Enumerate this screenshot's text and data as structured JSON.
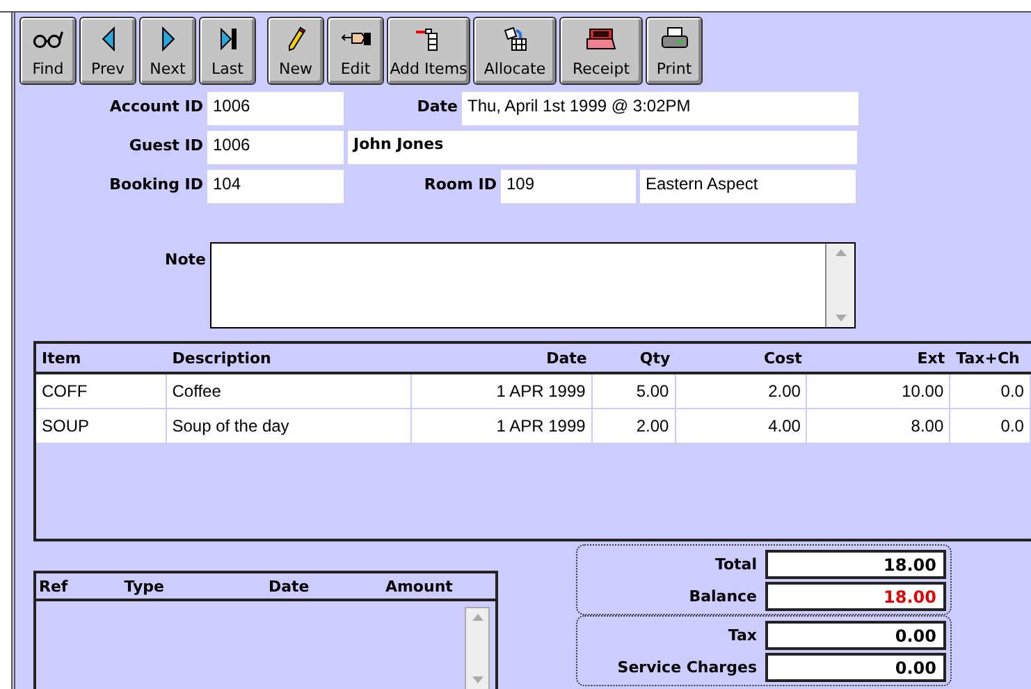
{
  "toolbar": {
    "navigation": [
      {
        "kind": "find",
        "label": "Find"
      },
      {
        "kind": "prev",
        "label": "Prev"
      },
      {
        "kind": "next",
        "label": "Next"
      },
      {
        "kind": "last",
        "label": "Last"
      }
    ],
    "actions": [
      {
        "kind": "new",
        "label": "New"
      },
      {
        "kind": "edit",
        "label": "Edit"
      },
      {
        "kind": "add",
        "label": "Add Items"
      },
      {
        "kind": "allocate",
        "label": "Allocate"
      },
      {
        "kind": "receipt",
        "label": "Receipt"
      },
      {
        "kind": "print",
        "label": "Print"
      }
    ]
  },
  "form": {
    "account_id": {
      "label": "Account ID",
      "value": "1006"
    },
    "date": {
      "label": "Date",
      "value": "Thu, April 1st 1999 @ 3:02PM"
    },
    "guest_id": {
      "label": "Guest ID",
      "value": "1006"
    },
    "guest_name": {
      "value": "John Jones"
    },
    "booking_id": {
      "label": "Booking ID",
      "value": "104"
    },
    "room_id": {
      "label": "Room ID",
      "value": "109"
    },
    "room_description": {
      "value": "Eastern Aspect"
    },
    "note": {
      "label": "Note"
    }
  },
  "items_table": {
    "columns": [
      "Item",
      "Description",
      "Date",
      "Qty",
      "Cost",
      "Ext",
      "Tax+Ch"
    ],
    "rows": [
      [
        "COFF",
        "Coffee",
        "1 APR 1999",
        "5.00",
        "2.00",
        "10.00",
        "0.0"
      ],
      [
        "SOUP",
        "Soup of the day",
        "1 APR 1999",
        "2.00",
        "4.00",
        "8.00",
        "0.0"
      ]
    ]
  },
  "payments_table": {
    "columns": [
      "Ref",
      "Type",
      "Date",
      "Amount"
    ]
  },
  "totals": [
    {
      "label": "Total",
      "value": "18.00",
      "alert": false
    },
    {
      "label": "Balance",
      "value": "18.00",
      "alert": true
    }
  ],
  "charges": [
    {
      "label": "Tax",
      "value": "0.00",
      "alert": false
    },
    {
      "label": "Service Charges",
      "value": "0.00",
      "alert": false
    }
  ]
}
